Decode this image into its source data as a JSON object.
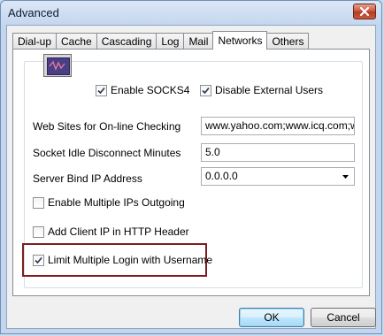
{
  "window": {
    "title": "Advanced"
  },
  "tabs": [
    {
      "label": "Dial-up",
      "active": false
    },
    {
      "label": "Cache",
      "active": false
    },
    {
      "label": "Cascading",
      "active": false
    },
    {
      "label": "Log",
      "active": false
    },
    {
      "label": "Mail",
      "active": false
    },
    {
      "label": "Networks",
      "active": true
    },
    {
      "label": "Others",
      "active": false
    }
  ],
  "networks": {
    "enable_socks4": {
      "label": "Enable SOCKS4",
      "checked": true
    },
    "disable_external_users": {
      "label": "Disable External Users",
      "checked": true
    },
    "web_sites_label": "Web Sites for On-line Checking",
    "web_sites_value": "www.yahoo.com;www.icq.com;www",
    "socket_idle_label": "Socket Idle Disconnect Minutes",
    "socket_idle_value": "5.0",
    "server_bind_label": "Server Bind IP Address",
    "server_bind_value": "0.0.0.0",
    "multiple_ips": {
      "label": "Enable Multiple IPs Outgoing",
      "checked": false
    },
    "client_ip_header": {
      "label": "Add Client IP in HTTP Header",
      "checked": false
    },
    "limit_login": {
      "label": "Limit Multiple Login with Username",
      "checked": true
    }
  },
  "buttons": {
    "ok": "OK",
    "cancel": "Cancel"
  },
  "colors": {
    "highlight_border": "#7e1d1d",
    "accent": "#3c7fb1"
  }
}
